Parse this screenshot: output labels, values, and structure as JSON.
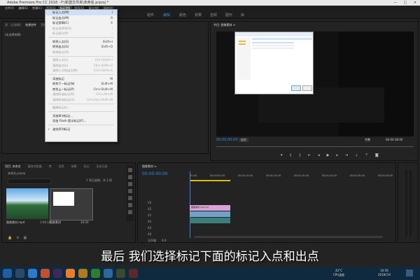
{
  "window": {
    "title": "Adobe Premiere Pro CC 2018 - F:\\新建文件夹\\未命名.prproj *",
    "controls": [
      "—",
      "□",
      "✕"
    ]
  },
  "menubar": [
    "文件(F)",
    "编辑(E)",
    "剪辑(C)",
    "序列(S)",
    "标记(M)",
    "图形(G)",
    "窗口(W)",
    "帮助(H)"
  ],
  "workspaces": {
    "items": [
      "组件",
      "编辑",
      "颜色",
      "效果",
      "音频",
      "图形",
      "库"
    ],
    "active": "编辑"
  },
  "marker_menu": {
    "items": [
      {
        "label": "标记入点(M)",
        "shortcut": "I",
        "disabled": false,
        "highlight": true
      },
      {
        "label": "标记出点(M)",
        "shortcut": "O",
        "disabled": false
      },
      {
        "label": "标记剪辑(C)",
        "shortcut": "X",
        "disabled": false
      },
      {
        "label": "标记选择项(S)",
        "shortcut": "/",
        "disabled": true
      },
      {
        "label": "标记拆分(P)",
        "shortcut": "›",
        "disabled": true
      },
      {
        "sep": true
      },
      {
        "label": "转到入点(G)",
        "shortcut": "Shift+I",
        "disabled": false
      },
      {
        "label": "转到出点(G)",
        "shortcut": "Shift+O",
        "disabled": false
      },
      {
        "label": "转到拆分(O)",
        "shortcut": "›",
        "disabled": true
      },
      {
        "sep": true
      },
      {
        "label": "清除入点(L)",
        "shortcut": "Ctrl+Shift+I",
        "disabled": true
      },
      {
        "label": "清除出点(L)",
        "shortcut": "Ctrl+Shift+O",
        "disabled": true
      },
      {
        "label": "清除入点和出点(N)",
        "shortcut": "Ctrl+Shift+X",
        "disabled": true
      },
      {
        "sep": true
      },
      {
        "label": "添加标记",
        "shortcut": "M",
        "disabled": false
      },
      {
        "label": "转到下一标记(N)",
        "shortcut": "Shift+M",
        "disabled": false
      },
      {
        "label": "转到上一标记(P)",
        "shortcut": "Ctrl+Shift+M",
        "disabled": false
      },
      {
        "label": "清除所选标记(K)",
        "shortcut": "Ctrl+Alt+M",
        "disabled": true
      },
      {
        "label": "清除所有标记(A)",
        "shortcut": "Ctrl+Alt+Shift+M",
        "disabled": true
      },
      {
        "sep": true
      },
      {
        "label": "编辑标记(I)...",
        "shortcut": "",
        "disabled": true
      },
      {
        "sep": true
      },
      {
        "label": "添加章节标记...",
        "shortcut": "",
        "disabled": false
      },
      {
        "label": "添加 Flash 提示标记(F)...",
        "shortcut": "",
        "disabled": false
      },
      {
        "sep": true
      },
      {
        "label": "波纹序列标记",
        "shortcut": "",
        "disabled": false,
        "checked": true
      }
    ]
  },
  "source_panel": {
    "tabs": [
      "源：(无剪辑)",
      "效果控件",
      "音频剪辑混合器"
    ],
    "empty_text": "(未选择剪辑)"
  },
  "program_panel": {
    "title": "节目: 图像素材 ≡",
    "timecode_left": "00:00:00:00",
    "fit": "适合",
    "quality": "完整",
    "timecode_right": "00:00:38:00"
  },
  "project_panel": {
    "tabs": [
      "项目: 未命名",
      "媒体浏览器",
      "库",
      "信息",
      "效果",
      "标记",
      "历史记录"
    ],
    "project_file": "未命名.prproj",
    "item_count": "1 项已选择，共 2 项",
    "items": [
      {
        "name": "图像素材.mp4",
        "duration": "1:00:10"
      },
      {
        "name": "图像素材",
        "duration": "38:00"
      }
    ]
  },
  "timeline_panel": {
    "tab": "图像素材 ≡",
    "timecode": "00:00:00:00",
    "ruler": [
      "00:00",
      "00:00:05:00",
      "00:00:10:00",
      "00:00:15:00",
      "00:00:20:00",
      "00:00:25:00",
      "00:00:30:00",
      "00:00:35:00"
    ],
    "tracks": [
      "V3",
      "V2",
      "V1",
      "A1",
      "A2",
      "A3"
    ],
    "master": "主声道",
    "master_value": "0.0",
    "clip_label": "图像素材.mp4 [V]"
  },
  "caption": "最后 我们选择标记下面的标记入点和出点",
  "taskbar": {
    "temp": "42°C",
    "temp_label": "CPU温度",
    "time": "10:56",
    "date": "2019/7/4"
  }
}
